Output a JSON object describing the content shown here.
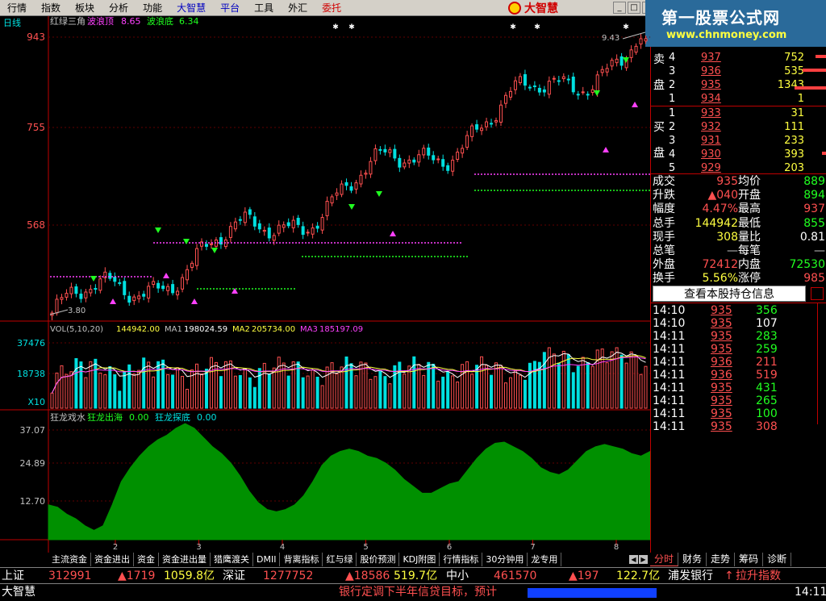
{
  "menu": [
    "行情",
    "指数",
    "板块",
    "分析",
    "功能",
    "大智慧",
    "平台",
    "工具",
    "外汇",
    "委托"
  ],
  "brand": "大智慧",
  "window_controls": [
    "_",
    "□",
    "×"
  ],
  "banner": {
    "title": "第一股票公式网",
    "url": "www.chnmoney.com"
  },
  "chart": {
    "period_label": "日线",
    "indicator_name": "红绿三角",
    "wave_top_label": "波浪顶",
    "wave_top_value": "8.65",
    "wave_bottom_label": "波浪底",
    "wave_bottom_value": "6.34",
    "price_axis": [
      "943",
      "755",
      "568"
    ],
    "high_label": "9.43",
    "low_label": "3.80",
    "vol_header": {
      "name": "VOL(5,10,20)",
      "value": "144942.00",
      "ma1_label": "MA1",
      "ma1": "198024.59",
      "ma2_label": "MA2",
      "ma2": "205734.00",
      "ma3_label": "MA3",
      "ma3": "185197.09"
    },
    "vol_axis": [
      "37476",
      "18738"
    ],
    "vol_multiplier": "X10",
    "dragon_header": {
      "name": "狂龙戏水",
      "l1_label": "狂龙出海",
      "l1": "0.00",
      "l2_label": "狂龙探底",
      "l2": "0.00"
    },
    "dragon_axis": [
      "37.07",
      "24.89",
      "12.70"
    ],
    "month_labels": [
      "2",
      "3",
      "4",
      "5",
      "6",
      "7",
      "8"
    ]
  },
  "chart_data": [
    {
      "type": "line",
      "title": "红绿三角",
      "ylim": [
        3.8,
        9.43
      ],
      "note": "daily candlestick price"
    },
    {
      "type": "bar",
      "title": "VOL(5,10,20)",
      "ylim": [
        0,
        37476
      ]
    },
    {
      "type": "area",
      "title": "狂龙戏水",
      "ylim": [
        0,
        37.07
      ]
    }
  ],
  "colors": {
    "up": "#ff5050",
    "down": "#00e0e0",
    "wave_top": "#ff40ff",
    "wave_bottom": "#20ff20",
    "dragon": "#009000",
    "axis": "#c00000"
  },
  "sell": {
    "label1": "卖",
    "label2": "盘",
    "rows": [
      {
        "lvl": "4",
        "price": "937",
        "vol": "752"
      },
      {
        "lvl": "3",
        "price": "936",
        "vol": "535"
      },
      {
        "lvl": "2",
        "price": "935",
        "vol": "1343"
      },
      {
        "lvl": "1",
        "price": "934",
        "vol": "1"
      }
    ]
  },
  "buy": {
    "label1": "买",
    "label2": "盘",
    "rows": [
      {
        "lvl": "1",
        "price": "933",
        "vol": "31"
      },
      {
        "lvl": "2",
        "price": "932",
        "vol": "111"
      },
      {
        "lvl": "3",
        "price": "931",
        "vol": "233"
      },
      {
        "lvl": "4",
        "price": "930",
        "vol": "393"
      },
      {
        "lvl": "5",
        "price": "929",
        "vol": "203"
      }
    ]
  },
  "stats": [
    {
      "l1": "成交",
      "v1": "935",
      "c1": "red",
      "l2": "均价",
      "v2": "889",
      "c2": "green"
    },
    {
      "l1": "升跌",
      "v1": "▲040",
      "c1": "red",
      "l2": "开盘",
      "v2": "894",
      "c2": "green"
    },
    {
      "l1": "幅度",
      "v1": "4.47%",
      "c1": "red",
      "l2": "最高",
      "v2": "937",
      "c2": "red"
    },
    {
      "l1": "总手",
      "v1": "144942",
      "c1": "yellow",
      "l2": "最低",
      "v2": "855",
      "c2": "green"
    },
    {
      "l1": "现手",
      "v1": "308",
      "c1": "yellow",
      "l2": "量比",
      "v2": "0.81",
      "c2": "white"
    },
    {
      "l1": "总笔",
      "v1": "—",
      "c1": "gray",
      "l2": "每笔",
      "v2": "—",
      "c2": "gray"
    },
    {
      "l1": "外盘",
      "v1": "72412",
      "c1": "red",
      "l2": "内盘",
      "v2": "72530",
      "c2": "green"
    },
    {
      "l1": "换手",
      "v1": "5.56%",
      "c1": "yellow",
      "l2": "涨停",
      "v2": "985",
      "c2": "red"
    }
  ],
  "holdings_button": "查看本股持仓信息",
  "ticks": [
    {
      "t": "14:10",
      "p": "935",
      "v": "356",
      "c": "green"
    },
    {
      "t": "14:10",
      "p": "935",
      "v": "107",
      "c": "white"
    },
    {
      "t": "14:11",
      "p": "935",
      "v": "283",
      "c": "green"
    },
    {
      "t": "14:11",
      "p": "935",
      "v": "259",
      "c": "green"
    },
    {
      "t": "14:11",
      "p": "936",
      "v": "211",
      "c": "red"
    },
    {
      "t": "14:11",
      "p": "936",
      "v": "519",
      "c": "red"
    },
    {
      "t": "14:11",
      "p": "935",
      "v": "431",
      "c": "green"
    },
    {
      "t": "14:11",
      "p": "935",
      "v": "265",
      "c": "green"
    },
    {
      "t": "14:11",
      "p": "935",
      "v": "100",
      "c": "green"
    },
    {
      "t": "14:11",
      "p": "935",
      "v": "308",
      "c": "red"
    }
  ],
  "bottom_tabs": [
    "主流资金",
    "资金进出",
    "资金",
    "资金进出量",
    "猎鹰渡关",
    "DMII",
    "背离指标",
    "红与绿",
    "股价预测",
    "KDJ附图",
    "行情指标",
    "30分钟用",
    "龙专用"
  ],
  "right_tabs": [
    "分时",
    "财务",
    "走势",
    "筹码",
    "诊断"
  ],
  "status1": {
    "sh_label": "上证",
    "sh_val": "312991",
    "sh_chg": "▲1719",
    "sh_amt": "1059.8亿",
    "sz_label": "深证",
    "sz_val": "1277752",
    "sz_chg": "▲18586",
    "sz_amt": "519.7亿",
    "zx_label": "中小",
    "zx_val": "461570",
    "zx_chg": "▲197",
    "zx_amt": "122.7亿",
    "stock_name": "浦发银行",
    "arrow": "↑",
    "index_name": "拉升指数"
  },
  "status2": {
    "app": "大智慧",
    "news": "银行定调下半年信贷目标，预计",
    "time": "14:11"
  }
}
